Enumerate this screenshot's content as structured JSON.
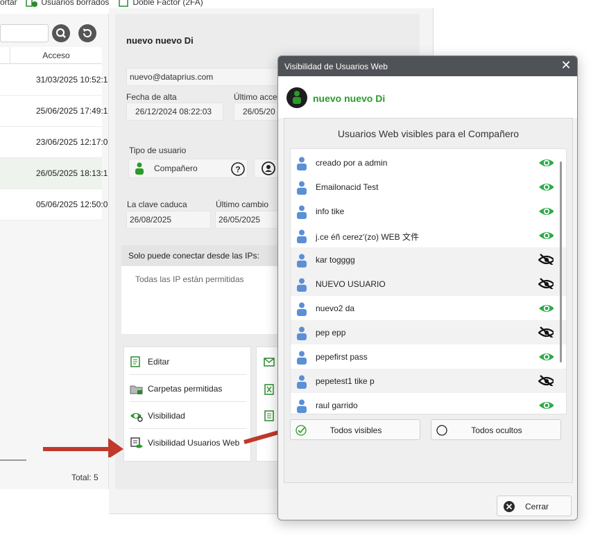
{
  "topbar": {
    "item1": "ortar",
    "item2": "Usuarios borrados",
    "item3": "Doble Factor (2FA)"
  },
  "left": {
    "col_acceso": "Acceso",
    "rows": [
      "31/03/2025 10:52:1",
      "25/06/2025 17:49:1",
      "23/06/2025 12:17:0",
      "26/05/2025 18:13:1",
      "05/06/2025 12:50:0"
    ],
    "total": "Total: 5"
  },
  "detail": {
    "name": "nuevo nuevo Di",
    "email": "nuevo@dataprius.com",
    "fecha_alta_label": "Fecha de alta",
    "fecha_alta": "26/12/2024 08:22:03",
    "ultimo_acceso_label": "Último acces",
    "ultimo_acceso": "26/05/20",
    "tipo_label": "Tipo de usuario",
    "tipo_value": "Compañero",
    "clave_label": "La clave caduca",
    "clave_value": "26/08/2025",
    "cambio_label": "Último cambio",
    "cambio_value": "26/05/2025",
    "ip_header": "Solo puede conectar desde las IPs:",
    "ip_body": "Todas las IP están permitidas",
    "actions": [
      "Editar",
      "Carpetas permitidas",
      "Visibilidad",
      "Visibilidad Usuarios Web"
    ]
  },
  "dialog": {
    "title": "Visibilidad de Usuarios Web",
    "user_name": "nuevo nuevo Di",
    "subtitle": "Usuarios Web visibles para el Compañero",
    "users": [
      {
        "name": "creado por a admin",
        "visible": true
      },
      {
        "name": "Emailonacid Test",
        "visible": true
      },
      {
        "name": "info tike",
        "visible": true
      },
      {
        "name": "j.ce éñ cerez'(zo) WEB 文件",
        "visible": true
      },
      {
        "name": "kar togggg",
        "visible": false
      },
      {
        "name": "NUEVO USUARIO",
        "visible": false
      },
      {
        "name": "nuevo2 da",
        "visible": true
      },
      {
        "name": "pep epp",
        "visible": false
      },
      {
        "name": "pepefirst pass",
        "visible": true
      },
      {
        "name": "pepetest1 tike p",
        "visible": false
      },
      {
        "name": "raul garrido",
        "visible": true
      }
    ],
    "all_visible": "Todos visibles",
    "all_hidden": "Todos ocultos",
    "close": "Cerrar"
  },
  "colors": {
    "accent_green": "#2a9a2a",
    "eye_green": "#2eaa4a",
    "user_blue": "#5b8fd6",
    "arrow_red": "#c0392b",
    "title_bar": "#4f5257"
  }
}
